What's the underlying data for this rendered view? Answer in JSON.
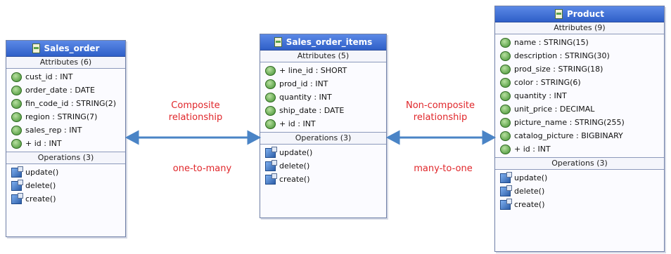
{
  "classes": {
    "sales_order": {
      "title": "Sales_order",
      "attr_header": "Attributes (6)",
      "attributes": [
        "cust_id : INT",
        "order_date : DATE",
        "fin_code_id : STRING(2)",
        "region : STRING(7)",
        "sales_rep : INT",
        "+ id : INT"
      ],
      "ops_header": "Operations (3)",
      "operations": [
        "update()",
        "delete()",
        "create()"
      ]
    },
    "sales_order_items": {
      "title": "Sales_order_items",
      "attr_header": "Attributes (5)",
      "attributes": [
        "+ line_id : SHORT",
        "prod_id : INT",
        "quantity : INT",
        "ship_date : DATE",
        "+ id : INT"
      ],
      "ops_header": "Operations (3)",
      "operations": [
        "update()",
        "delete()",
        "create()"
      ]
    },
    "product": {
      "title": "Product",
      "attr_header": "Attributes (9)",
      "attributes": [
        "name : STRING(15)",
        "description : STRING(30)",
        "prod_size : STRING(18)",
        "color : STRING(6)",
        "quantity : INT",
        "unit_price : DECIMAL",
        "picture_name : STRING(255)",
        "catalog_picture : BIGBINARY",
        "+ id : INT"
      ],
      "ops_header": "Operations (3)",
      "operations": [
        "update()",
        "delete()",
        "create()"
      ]
    }
  },
  "labels": {
    "left_top": "Composite relationship",
    "left_bottom": "one-to-many",
    "right_top": "Non-composite relationship",
    "right_bottom": "many-to-one"
  },
  "colors": {
    "header": "#3f6fd6",
    "label": "#e0262a",
    "arrow": "#4a84c6"
  }
}
